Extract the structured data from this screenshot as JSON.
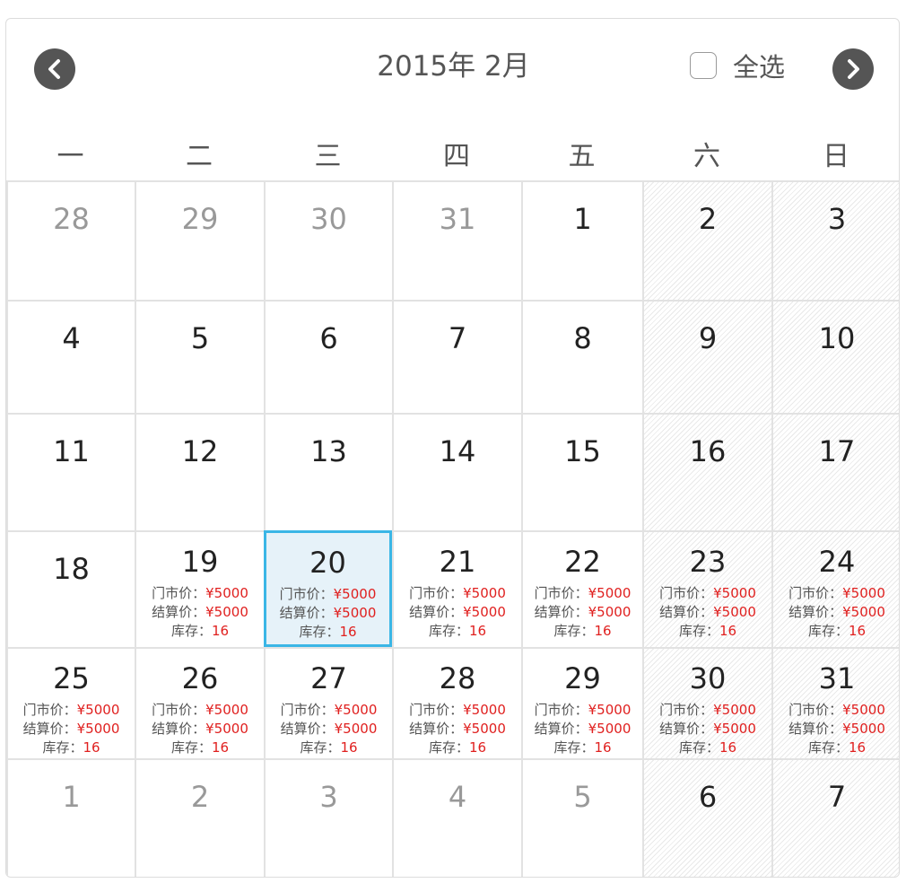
{
  "header": {
    "title": "2015年  2月",
    "select_all_label": "全选",
    "prev_icon": "chevron-left-icon",
    "next_icon": "chevron-right-icon"
  },
  "weekdays": [
    "一",
    "二",
    "三",
    "四",
    "五",
    "六",
    "日"
  ],
  "price_labels": {
    "market": "门市价：",
    "settle": "结算价：",
    "stock": "库存："
  },
  "price_values": {
    "market": "¥5000",
    "settle": "¥5000",
    "stock": "16"
  },
  "weeks": [
    [
      {
        "day": "28",
        "other": true
      },
      {
        "day": "29",
        "other": true
      },
      {
        "day": "30",
        "other": true
      },
      {
        "day": "31",
        "other": true
      },
      {
        "day": "1"
      },
      {
        "day": "2"
      },
      {
        "day": "3"
      }
    ],
    [
      {
        "day": "4"
      },
      {
        "day": "5"
      },
      {
        "day": "6"
      },
      {
        "day": "7"
      },
      {
        "day": "8"
      },
      {
        "day": "9"
      },
      {
        "day": "10"
      }
    ],
    [
      {
        "day": "11"
      },
      {
        "day": "12"
      },
      {
        "day": "13"
      },
      {
        "day": "14"
      },
      {
        "day": "15"
      },
      {
        "day": "16"
      },
      {
        "day": "17"
      }
    ],
    [
      {
        "day": "18"
      },
      {
        "day": "19",
        "priced": true
      },
      {
        "day": "20",
        "priced": true,
        "selected": true
      },
      {
        "day": "21",
        "priced": true
      },
      {
        "day": "22",
        "priced": true
      },
      {
        "day": "23",
        "priced": true
      },
      {
        "day": "24",
        "priced": true
      }
    ],
    [
      {
        "day": "25",
        "priced": true
      },
      {
        "day": "26",
        "priced": true
      },
      {
        "day": "27",
        "priced": true
      },
      {
        "day": "28",
        "priced": true
      },
      {
        "day": "29",
        "priced": true
      },
      {
        "day": "30",
        "priced": true
      },
      {
        "day": "31",
        "priced": true
      }
    ],
    [
      {
        "day": "1",
        "other": true
      },
      {
        "day": "2",
        "other": true
      },
      {
        "day": "3",
        "other": true
      },
      {
        "day": "4",
        "other": true
      },
      {
        "day": "5",
        "other": true
      },
      {
        "day": "6"
      },
      {
        "day": "7"
      }
    ]
  ],
  "colors": {
    "price_value": "#e0201f",
    "selected_border": "#3ab6e6",
    "selected_bg": "#e6f2f9",
    "nav_button": "#555555"
  }
}
